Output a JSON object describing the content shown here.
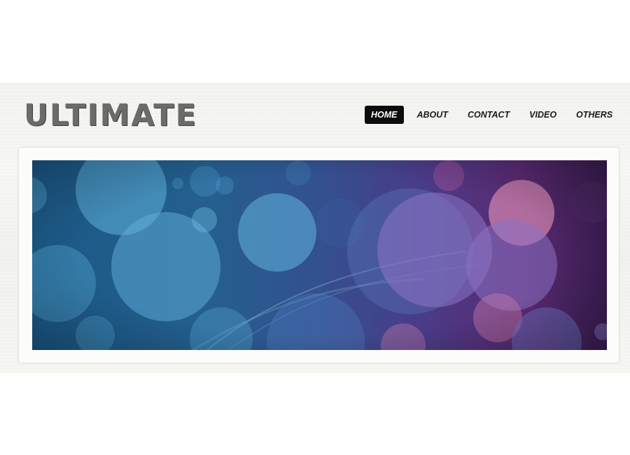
{
  "site": {
    "logo_text": "ULTIMATE"
  },
  "nav": {
    "items": [
      {
        "label": "HOME",
        "active": true
      },
      {
        "label": "ABOUT",
        "active": false
      },
      {
        "label": "CONTACT",
        "active": false
      },
      {
        "label": "VIDEO",
        "active": false
      },
      {
        "label": "OTHERS",
        "active": false
      }
    ]
  },
  "banner": {
    "description_icon": "bokeh-circles-image"
  },
  "colors": {
    "nav_active_bg": "#0c0c0c",
    "nav_active_text": "#ffffff",
    "logo": "#6b6b69",
    "banner_left": "#1d5a86",
    "banner_right": "#57286f"
  }
}
